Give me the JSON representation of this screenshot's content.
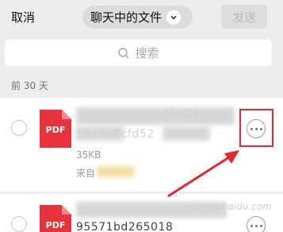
{
  "header": {
    "cancel_label": "取消",
    "title": "聊天中的文件",
    "send_label": "发送"
  },
  "search": {
    "placeholder": "搜索"
  },
  "section": {
    "label": "前 30 天"
  },
  "files": [
    {
      "icon_label": "PDF",
      "name_line1": "4b001",
      "name_line2": "58e4a7cfd52",
      "size": "35KB",
      "from_prefix": "来自"
    },
    {
      "icon_label": "PDF",
      "name_line1": "95571bd265018",
      "name_line2": ""
    }
  ],
  "watermark": "jingyan.baidu.com",
  "colors": {
    "pdf_red": "#e8333c",
    "annotation_red": "#e8262c"
  }
}
